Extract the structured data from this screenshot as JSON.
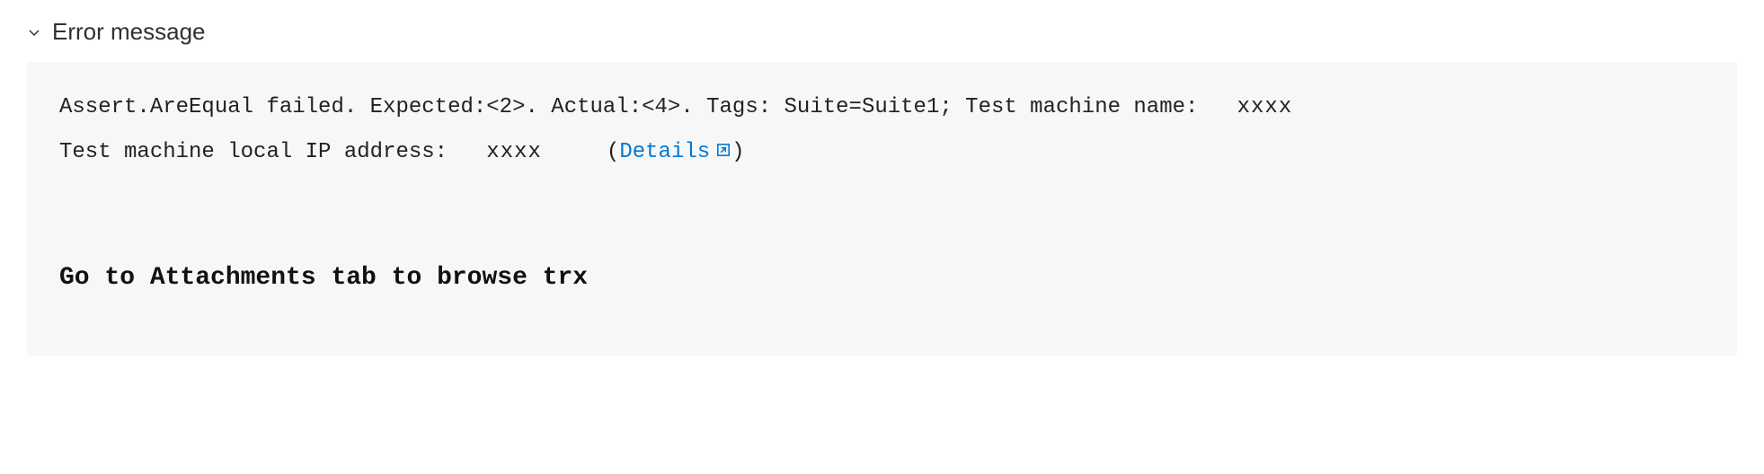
{
  "header": {
    "title": "Error message"
  },
  "error": {
    "line1_prefix": "Assert.AreEqual failed. Expected:<2>. Actual:<4>. Tags: Suite=Suite1; Test machine name: ",
    "machine_name": "xxxx",
    "line2_prefix": "Test machine local IP address: ",
    "ip_value": "xxxx",
    "paren_open": " (",
    "details_label": "Details",
    "paren_close": ")",
    "bold_line": "Go to Attachments tab to browse trx"
  }
}
